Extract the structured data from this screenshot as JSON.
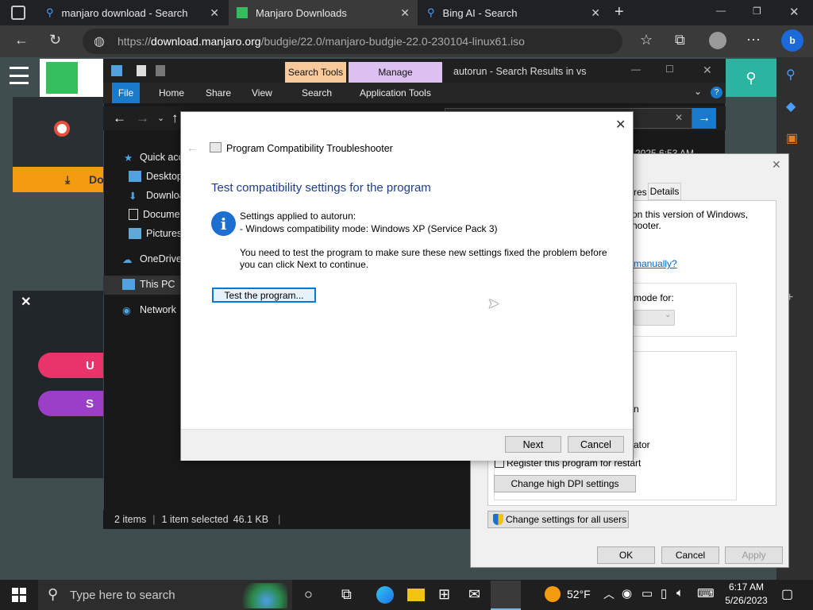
{
  "browser": {
    "tabs": [
      {
        "label": "manjaro download - Search"
      },
      {
        "label": "Manjaro Downloads"
      },
      {
        "label": "Bing AI - Search"
      }
    ],
    "url_prefix": "https://",
    "url_host": "download.manjaro.org",
    "url_path": "/budgie/22.0/manjaro-budgie-22.0-230104-linux61.iso"
  },
  "webpage": {
    "download_label": "Do",
    "pill1": "U",
    "pill2": "S"
  },
  "explorer": {
    "context_tabs": [
      "Search Tools",
      "Manage"
    ],
    "title": "autorun - Search Results in vs",
    "ribbon": [
      "File",
      "Home",
      "Share",
      "View",
      "Search",
      "Application Tools"
    ],
    "nav": [
      "Quick acc",
      "Desktop",
      "Downloa",
      "Docume",
      "Pictures",
      "OneDrive",
      "This PC",
      "Network"
    ],
    "status": {
      "items": "2 items",
      "selected": "1 item selected",
      "size": "46.1 KB"
    },
    "search_date": "2025 6:53 AM"
  },
  "properties": {
    "tabs_partial": [
      "res",
      "Details"
    ],
    "line1": "on this version of Windows,",
    "line2": "hooter.",
    "link": "manually?",
    "mode_for": "mode for:",
    "opt_n": "n",
    "opt_ator": "ator",
    "register": "Register this program for restart",
    "dpi_button": "Change high DPI settings",
    "all_users_button": "Change settings for all users",
    "ok": "OK",
    "cancel": "Cancel",
    "apply": "Apply"
  },
  "dialog": {
    "title": "Program Compatibility Troubleshooter",
    "heading": "Test compatibility settings for the program",
    "applied_to": "Settings applied to autorun:",
    "mode": "- Windows compatibility mode: Windows XP (Service Pack 3)",
    "instruction1": "You need to test the program to make sure these new settings fixed the problem before",
    "instruction2": "you can click Next to continue.",
    "test_button": "Test the program...",
    "next": "Next",
    "cancel": "Cancel"
  },
  "taskbar": {
    "search_placeholder": "Type here to search",
    "temp": "52°F",
    "time": "6:17 AM",
    "date": "5/26/2023"
  }
}
